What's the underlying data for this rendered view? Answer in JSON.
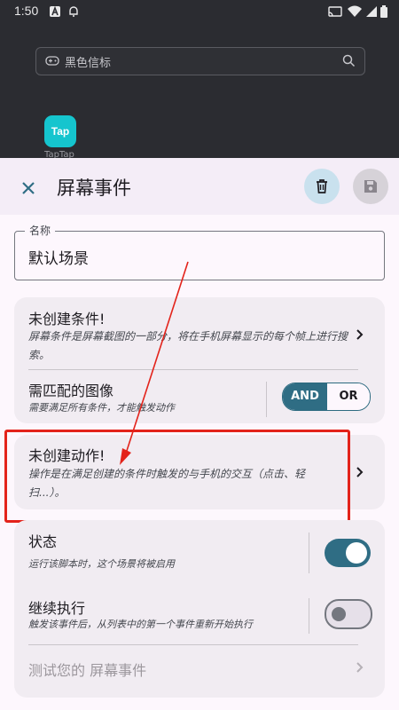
{
  "status_bar": {
    "time": "1:50"
  },
  "background_app": {
    "search_placeholder": "黑色信标",
    "app_icon_text": "Tap",
    "app_label": "TapTap"
  },
  "header": {
    "title": "屏幕事件"
  },
  "name_field": {
    "label": "名称",
    "value": "默认场景"
  },
  "conditions_card": {
    "title": "未创建条件!",
    "description": "屏幕条件是屏幕截图的一部分，将在手机屏幕显示的每个帧上进行搜索。",
    "match_title": "需匹配的图像",
    "match_desc": "需要满足所有条件，才能触发动作",
    "and_label": "AND",
    "or_label": "OR"
  },
  "actions_card": {
    "title": "未创建动作!",
    "description": "操作是在满足创建的条件时触发的与手机的交互（点击、轻扫...）。"
  },
  "settings_card": {
    "state_title": "状态",
    "state_desc": "运行该脚本时，这个场景将被启用",
    "continue_title": "继续执行",
    "continue_desc": "触发该事件后，从列表中的第一个事件重新开始执行",
    "test_label": "测试您的 屏幕事件"
  },
  "colors": {
    "accent": "#2f6d84",
    "highlight": "#e3231b"
  }
}
